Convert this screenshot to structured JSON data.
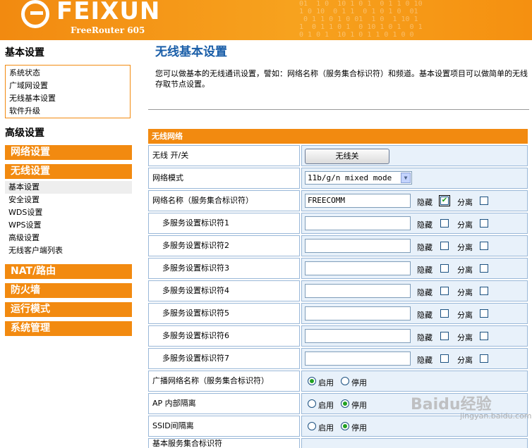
{
  "header": {
    "brand": "FEIXUN",
    "model": "FreeRouter 605",
    "binary": "01  1 0  10 1 0 1  0 1 1 0 10\n1 0 10  0 1 1  0 1 0 1 0  01\n 0 1 1 0 1 0 01  1 0  1 10 1\n1  0 1 1 0 1  0 10 1 0 1  0 1\n0 1 0 1  10 1 0 1 1 0 1 0 0"
  },
  "sidebar": {
    "basic_heading": "基本设置",
    "basic_links": [
      "系统状态",
      "广域网设置",
      "无线基本设置",
      "软件升级"
    ],
    "advanced_heading": "高级设置",
    "network": "网络设置",
    "wireless": "无线设置",
    "wireless_links": [
      "基本设置",
      "安全设置",
      "WDS设置",
      "WPS设置",
      "高级设置",
      "无线客户端列表"
    ],
    "nat": "NAT/路由",
    "firewall": "防火墙",
    "mode": "运行模式",
    "sysadmin": "系统管理"
  },
  "main": {
    "title": "无线基本设置",
    "description": "您可以做基本的无线通讯设置，譬如：网络名称（服务集合标识符）和频道。基本设置项目可以做简单的无线存取节点设置。"
  },
  "panel": {
    "heading": "无线网络",
    "wireless_label": "无线 开/关",
    "wireless_button": "无线关",
    "mode_label": "网络模式",
    "mode_value": "11b/g/n mixed mode",
    "ssid_label": "网络名称（服务集合标识符）",
    "ssid_value": "FREECOMM",
    "hide_label": "隐藏",
    "isolate_label": "分离",
    "multi_label_1": "多服务设置标识符1",
    "multi_label_2": "多服务设置标识符2",
    "multi_label_3": "多服务设置标识符3",
    "multi_label_4": "多服务设置标识符4",
    "multi_label_5": "多服务设置标识符5",
    "multi_label_6": "多服务设置标识符6",
    "multi_label_7": "多服务设置标识符7",
    "broadcast_label": "广播网络名称（服务集合标识符）",
    "ap_isolate_label": "AP 内部隔离",
    "ssid_isolate_label": "SSID间隔离",
    "enable_label": "启用",
    "disable_label": "停用",
    "bssid_label": "基本服务集合标识符"
  },
  "watermark": {
    "text": "Baidu经验",
    "sub": "jingyan.baidu.com"
  }
}
